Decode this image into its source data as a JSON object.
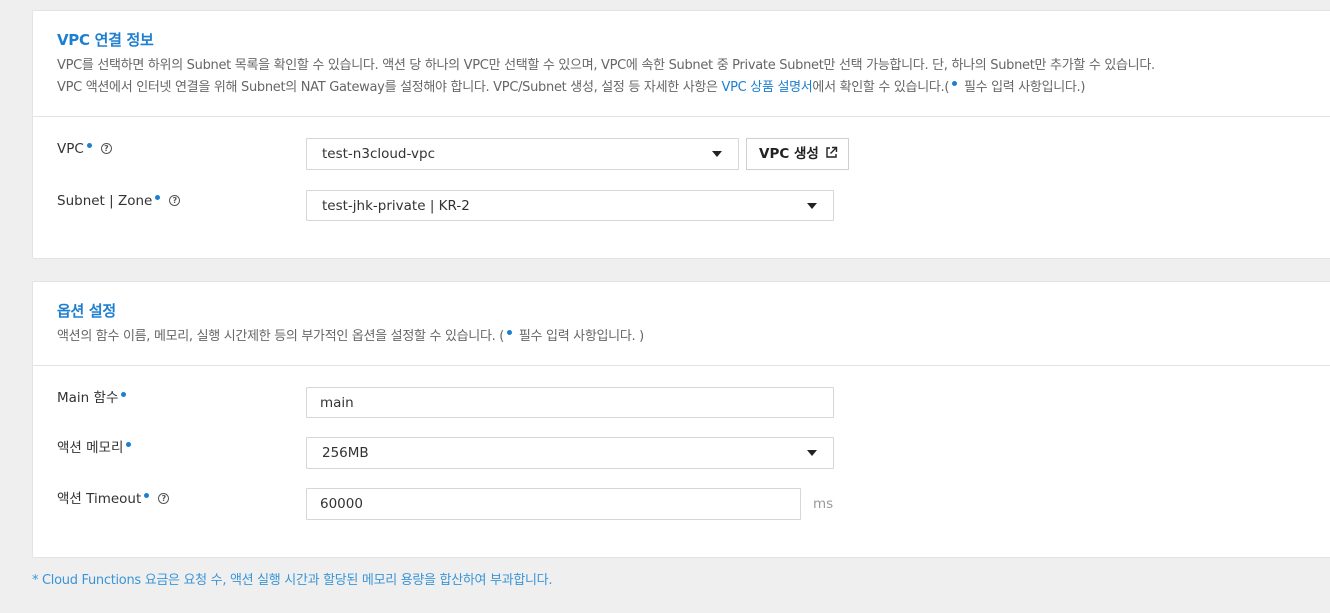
{
  "vpc_section": {
    "title": "VPC 연결 정보",
    "desc_line1": "VPC를 선택하면 하위의 Subnet 목록을 확인할 수 있습니다. 액션 당 하나의 VPC만 선택할 수 있으며, VPC에 속한 Subnet 중 Private Subnet만 선택 가능합니다. 단, 하나의 Subnet만 추가할 수 있습니다.",
    "desc_line2_prefix": "VPC 액션에서 인터넷 연결을 위해 Subnet의 NAT Gateway를 설정해야 합니다. VPC/Subnet 생성, 설정 등 자세한 사항은 ",
    "desc_line2_link": "VPC 상품 설명서",
    "desc_line2_suffix": "에서 확인할 수 있습니다.(",
    "desc_line2_required": " 필수 입력 사항입니다.)",
    "vpc_label": "VPC",
    "vpc_value": "test-n3cloud-vpc",
    "vpc_create_button": "VPC 생성",
    "subnet_label": "Subnet | Zone",
    "subnet_value": "test-jhk-private | KR-2"
  },
  "option_section": {
    "title": "옵션 설정",
    "desc_prefix": "액션의 함수 이름, 메모리, 실행 시간제한 등의 부가적인 옵션을 설정할 수 있습니다. (",
    "desc_required": " 필수 입력 사항입니다. )",
    "main_label": "Main 함수",
    "main_value": "main",
    "memory_label": "액션 메모리",
    "memory_value": "256MB",
    "timeout_label": "액션 Timeout",
    "timeout_value": "60000",
    "timeout_unit": "ms"
  },
  "footnote": "* Cloud Functions 요금은 요청 수, 액션 실행 시간과 할당된 메모리 용량을 합산하여 부과합니다.",
  "colors": {
    "accent": "#1e7fd0",
    "background": "#efefef"
  }
}
